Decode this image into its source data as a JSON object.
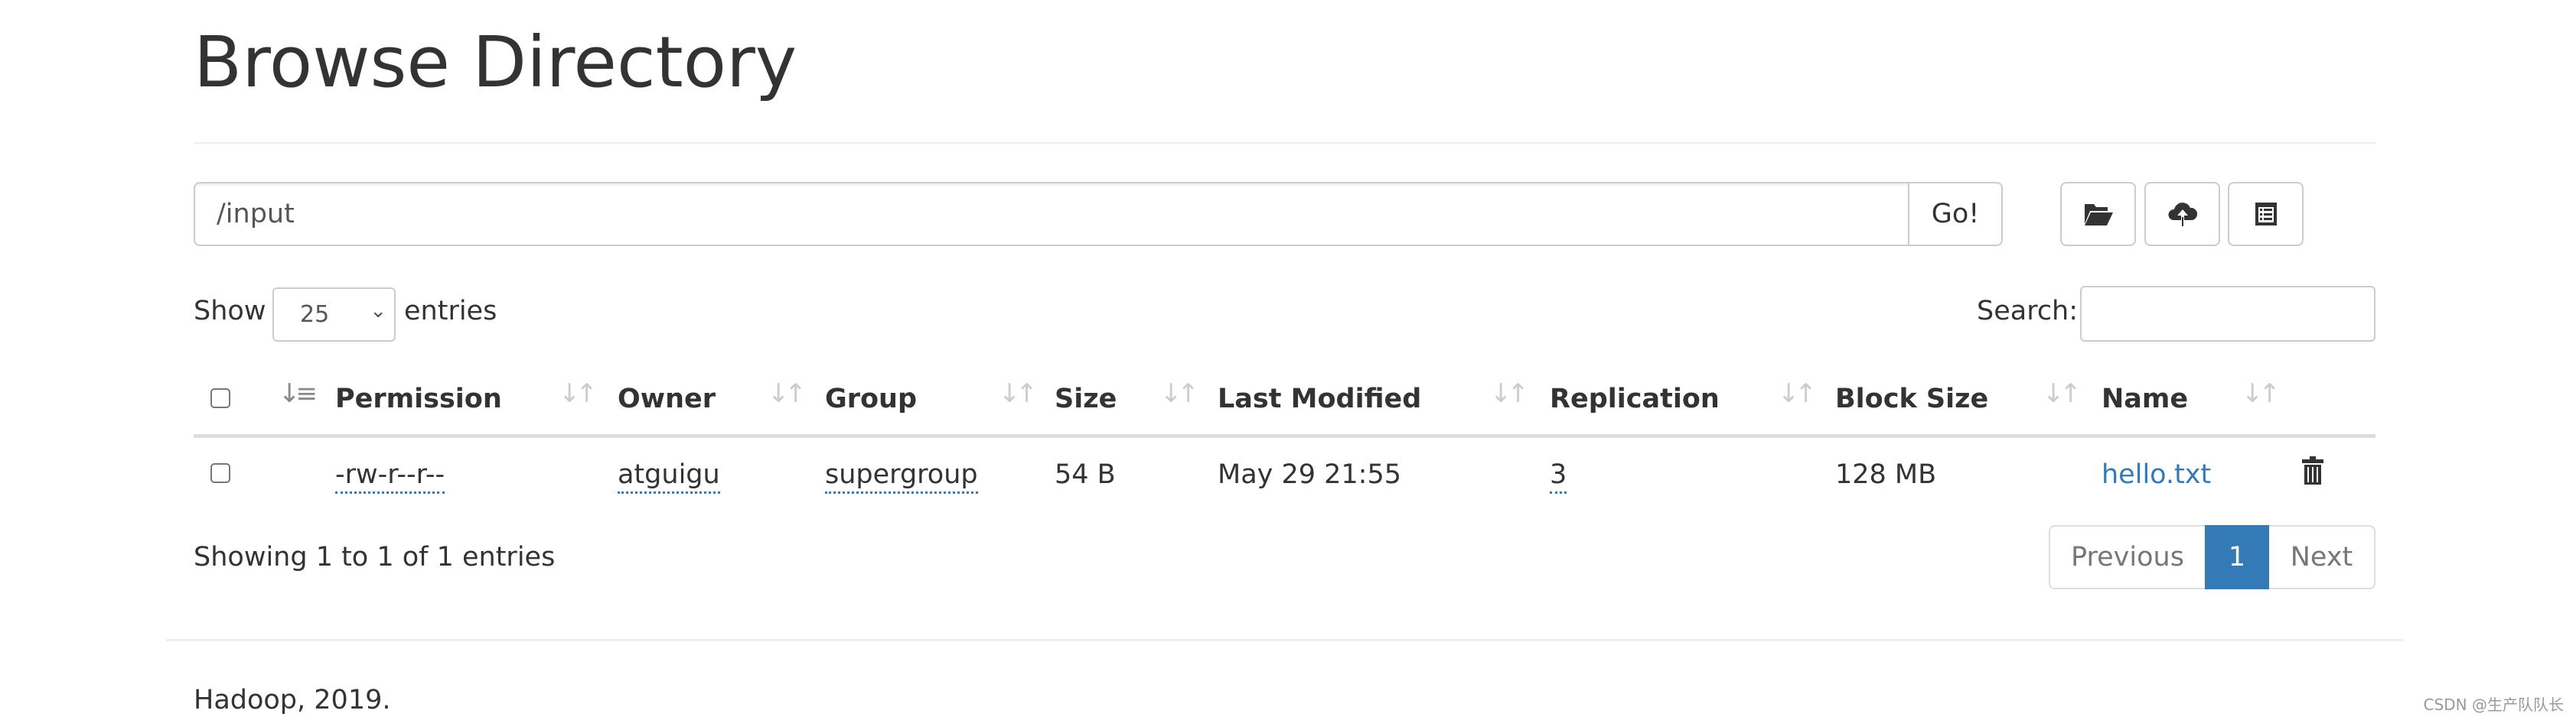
{
  "page": {
    "title": "Browse Directory"
  },
  "path_bar": {
    "value": "/input",
    "go_label": "Go!"
  },
  "toolbar": {
    "icons": [
      "folder-open-icon",
      "cloud-upload-icon",
      "list-alt-icon"
    ]
  },
  "length": {
    "show_label": "Show",
    "selected": "25",
    "entries_label": "entries"
  },
  "search": {
    "label": "Search:",
    "value": ""
  },
  "table": {
    "columns": [
      "Permission",
      "Owner",
      "Group",
      "Size",
      "Last Modified",
      "Replication",
      "Block Size",
      "Name"
    ],
    "rows": [
      {
        "permission": "-rw-r--r--",
        "owner": "atguigu",
        "group": "supergroup",
        "size": "54 B",
        "last_modified": "May 29 21:55",
        "replication": "3",
        "block_size": "128 MB",
        "name": "hello.txt"
      }
    ]
  },
  "info": "Showing 1 to 1 of 1 entries",
  "pagination": {
    "previous": "Previous",
    "current": "1",
    "next": "Next"
  },
  "footer": {
    "text": "Hadoop, 2019."
  },
  "watermark": "CSDN @生产队队长",
  "colors": {
    "link": "#337ab7",
    "active_page": "#337ab7"
  }
}
